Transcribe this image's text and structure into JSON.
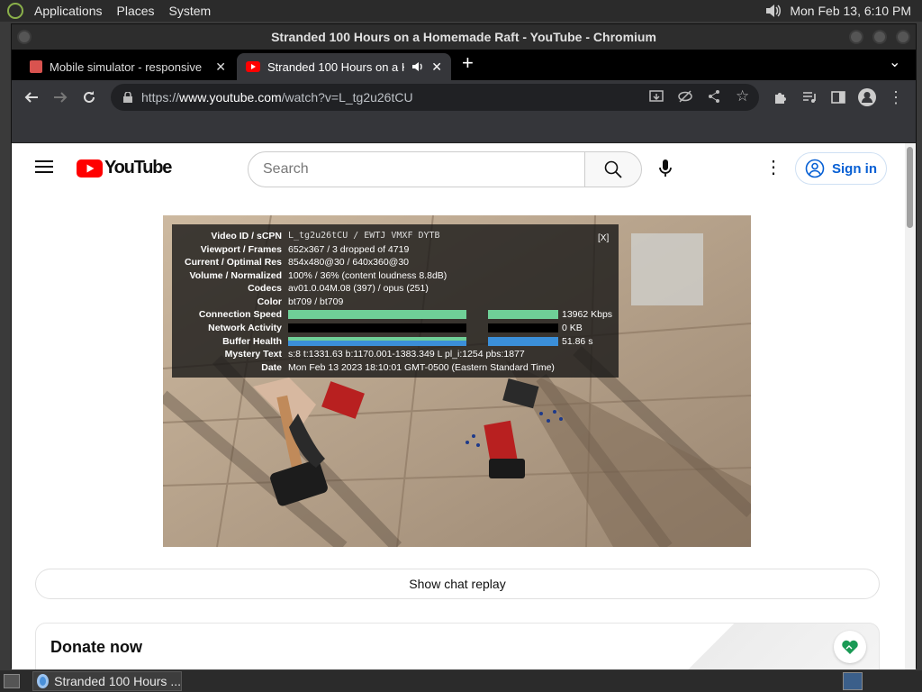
{
  "top_panel": {
    "menus": [
      "Applications",
      "Places",
      "System"
    ],
    "clock": "Mon Feb 13,  6:10 PM"
  },
  "window": {
    "title": "Stranded 100 Hours on a Homemade Raft - YouTube - Chromium"
  },
  "tabs": [
    {
      "title": "Mobile simulator - responsive",
      "active": false
    },
    {
      "title": "Stranded 100 Hours on a H",
      "active": true
    }
  ],
  "omnibox": {
    "prefix": "https://",
    "domain": "www.youtube.com",
    "path": "/watch?v=L_tg2u26tCU"
  },
  "youtube": {
    "logo_text": "YouTube",
    "search_placeholder": "Search",
    "sign_in": "Sign in"
  },
  "stats": {
    "close": "[X]",
    "rows": [
      {
        "label": "Video ID / sCPN",
        "value": "L_tg2u26tCU / EWTJ VMXF DYTB"
      },
      {
        "label": "Viewport / Frames",
        "value": "652x367 / 3 dropped of 4719"
      },
      {
        "label": "Current / Optimal Res",
        "value": "854x480@30 / 640x360@30"
      },
      {
        "label": "Volume / Normalized",
        "value": "100% / 36% (content loudness 8.8dB)"
      },
      {
        "label": "Codecs",
        "value": "av01.0.04M.08 (397) / opus (251)"
      },
      {
        "label": "Color",
        "value": "bt709 / bt709"
      },
      {
        "label": "Connection Speed",
        "value": "13962 Kbps"
      },
      {
        "label": "Network Activity",
        "value": "0 KB"
      },
      {
        "label": "Buffer Health",
        "value": "51.86 s"
      },
      {
        "label": "Mystery Text",
        "value": "s:8 t:1331.63 b:1170.001-1383.349 L pl_i:1254 pbs:1877"
      },
      {
        "label": "Date",
        "value": "Mon Feb 13 2023 18:10:01 GMT-0500 (Eastern Standard Time)"
      }
    ],
    "bar_colors": {
      "connection": "#6fcf97",
      "buffer": "#3b8fd9"
    }
  },
  "chat": {
    "button": "Show chat replay"
  },
  "donate": {
    "title": "Donate now"
  },
  "taskbar": {
    "task_title": "Stranded 100 Hours ..."
  }
}
